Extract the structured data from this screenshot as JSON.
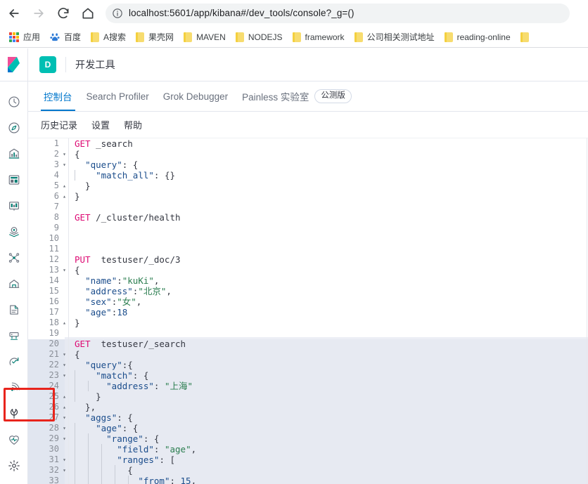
{
  "browser": {
    "nav": {
      "back": "back-arrow",
      "forward": "forward-arrow",
      "reload": "reload",
      "home": "home"
    },
    "omnibox": {
      "info_icon": "page-info-icon",
      "url": "localhost:5601/app/kibana#/dev_tools/console?_g=()"
    },
    "bookmarks": [
      {
        "label": "应用",
        "icon": "apps-grid-icon"
      },
      {
        "label": "百度",
        "icon": "baidu-icon"
      },
      {
        "label": "A搜索",
        "icon": "folder-icon"
      },
      {
        "label": "果壳网",
        "icon": "folder-icon"
      },
      {
        "label": "MAVEN",
        "icon": "folder-icon"
      },
      {
        "label": "NODEJS",
        "icon": "folder-icon"
      },
      {
        "label": "framework",
        "icon": "folder-icon"
      },
      {
        "label": "公司相关测试地址",
        "icon": "folder-icon"
      },
      {
        "label": "reading-online",
        "icon": "folder-icon"
      },
      {
        "label": "",
        "icon": "folder-icon"
      }
    ]
  },
  "kibana": {
    "logo": "kibana-logo",
    "app_badge": "D",
    "app_title": "开发工具",
    "tabs": [
      {
        "label": "控制台",
        "active": true
      },
      {
        "label": "Search Profiler",
        "active": false
      },
      {
        "label": "Grok Debugger",
        "active": false
      },
      {
        "label": "Painless 实验室",
        "active": false,
        "badge": "公测版"
      }
    ],
    "subbar": [
      {
        "label": "历史记录"
      },
      {
        "label": "设置"
      },
      {
        "label": "帮助"
      }
    ],
    "sidebar": [
      {
        "name": "recently-viewed-icon",
        "icon": "clock"
      },
      {
        "name": "discover-icon",
        "icon": "compass"
      },
      {
        "name": "visualize-icon",
        "icon": "bar-chart"
      },
      {
        "name": "dashboard-icon",
        "icon": "dashboard"
      },
      {
        "name": "canvas-icon",
        "icon": "canvas"
      },
      {
        "name": "maps-icon",
        "icon": "map-marker"
      },
      {
        "name": "machine-learning-icon",
        "icon": "ml-nodes"
      },
      {
        "name": "infrastructure-icon",
        "icon": "infra"
      },
      {
        "name": "logs-icon",
        "icon": "logs"
      },
      {
        "name": "apm-icon",
        "icon": "apm"
      },
      {
        "name": "uptime-icon",
        "icon": "uptime"
      },
      {
        "name": "siem-icon",
        "icon": "siem"
      },
      {
        "name": "dev-tools-icon",
        "icon": "wrench",
        "highlighted": true
      },
      {
        "name": "monitoring-icon",
        "icon": "heart-pulse"
      },
      {
        "name": "management-icon",
        "icon": "gear"
      }
    ],
    "console": {
      "selection_start_line": 20,
      "lines": [
        {
          "n": 1,
          "fold": "",
          "indent": 0,
          "tokens": [
            {
              "t": "GET",
              "c": "k-method"
            },
            {
              "t": " _search",
              "c": "k-url"
            }
          ]
        },
        {
          "n": 2,
          "fold": "▾",
          "indent": 0,
          "tokens": [
            {
              "t": "{",
              "c": "k-punc"
            }
          ]
        },
        {
          "n": 3,
          "fold": "▾",
          "indent": 0,
          "tokens": [
            {
              "t": "  ",
              "c": "k-punc"
            },
            {
              "t": "\"query\"",
              "c": "k-key"
            },
            {
              "t": ": {",
              "c": "k-punc"
            }
          ]
        },
        {
          "n": 4,
          "fold": "",
          "indent": 1,
          "tokens": [
            {
              "t": "    ",
              "c": "k-punc"
            },
            {
              "t": "\"match_all\"",
              "c": "k-key"
            },
            {
              "t": ": {}",
              "c": "k-punc"
            }
          ]
        },
        {
          "n": 5,
          "fold": "▴",
          "indent": 0,
          "tokens": [
            {
              "t": "  }",
              "c": "k-punc"
            }
          ]
        },
        {
          "n": 6,
          "fold": "▴",
          "indent": 0,
          "tokens": [
            {
              "t": "}",
              "c": "k-punc"
            }
          ]
        },
        {
          "n": 7,
          "fold": "",
          "indent": 0,
          "tokens": []
        },
        {
          "n": 8,
          "fold": "",
          "indent": 0,
          "tokens": [
            {
              "t": "GET",
              "c": "k-method"
            },
            {
              "t": " /_cluster/health",
              "c": "k-url"
            }
          ]
        },
        {
          "n": 9,
          "fold": "",
          "indent": 0,
          "tokens": []
        },
        {
          "n": 10,
          "fold": "",
          "indent": 0,
          "tokens": []
        },
        {
          "n": 11,
          "fold": "",
          "indent": 0,
          "tokens": []
        },
        {
          "n": 12,
          "fold": "",
          "indent": 0,
          "tokens": [
            {
              "t": "PUT",
              "c": "k-method"
            },
            {
              "t": "  testuser/_doc/3",
              "c": "k-url"
            }
          ]
        },
        {
          "n": 13,
          "fold": "▾",
          "indent": 0,
          "tokens": [
            {
              "t": "{",
              "c": "k-punc"
            }
          ]
        },
        {
          "n": 14,
          "fold": "",
          "indent": 0,
          "tokens": [
            {
              "t": "  ",
              "c": "k-punc"
            },
            {
              "t": "\"name\"",
              "c": "k-key"
            },
            {
              "t": ":",
              "c": "k-punc"
            },
            {
              "t": "\"kuKi\"",
              "c": "k-str"
            },
            {
              "t": ",",
              "c": "k-punc"
            }
          ]
        },
        {
          "n": 15,
          "fold": "",
          "indent": 0,
          "tokens": [
            {
              "t": "  ",
              "c": "k-punc"
            },
            {
              "t": "\"address\"",
              "c": "k-key"
            },
            {
              "t": ":",
              "c": "k-punc"
            },
            {
              "t": "\"北京\"",
              "c": "k-str"
            },
            {
              "t": ",",
              "c": "k-punc"
            }
          ]
        },
        {
          "n": 16,
          "fold": "",
          "indent": 0,
          "tokens": [
            {
              "t": "  ",
              "c": "k-punc"
            },
            {
              "t": "\"sex\"",
              "c": "k-key"
            },
            {
              "t": ":",
              "c": "k-punc"
            },
            {
              "t": "\"女\"",
              "c": "k-str"
            },
            {
              "t": ",",
              "c": "k-punc"
            }
          ]
        },
        {
          "n": 17,
          "fold": "",
          "indent": 0,
          "tokens": [
            {
              "t": "  ",
              "c": "k-punc"
            },
            {
              "t": "\"age\"",
              "c": "k-key"
            },
            {
              "t": ":",
              "c": "k-punc"
            },
            {
              "t": "18",
              "c": "k-num"
            }
          ]
        },
        {
          "n": 18,
          "fold": "▴",
          "indent": 0,
          "tokens": [
            {
              "t": "}",
              "c": "k-punc"
            }
          ]
        },
        {
          "n": 19,
          "fold": "",
          "indent": 0,
          "tokens": []
        },
        {
          "n": 20,
          "fold": "",
          "indent": 0,
          "tokens": [
            {
              "t": "GET",
              "c": "k-method"
            },
            {
              "t": "  testuser/_search",
              "c": "k-url"
            }
          ]
        },
        {
          "n": 21,
          "fold": "▾",
          "indent": 0,
          "tokens": [
            {
              "t": "{",
              "c": "k-punc"
            }
          ]
        },
        {
          "n": 22,
          "fold": "▾",
          "indent": 0,
          "tokens": [
            {
              "t": "  ",
              "c": "k-punc"
            },
            {
              "t": "\"query\"",
              "c": "k-key"
            },
            {
              "t": ":{",
              "c": "k-punc"
            }
          ]
        },
        {
          "n": 23,
          "fold": "▾",
          "indent": 1,
          "tokens": [
            {
              "t": "    ",
              "c": "k-punc"
            },
            {
              "t": "\"match\"",
              "c": "k-key"
            },
            {
              "t": ": {",
              "c": "k-punc"
            }
          ]
        },
        {
          "n": 24,
          "fold": "",
          "indent": 2,
          "tokens": [
            {
              "t": "      ",
              "c": "k-punc"
            },
            {
              "t": "\"address\"",
              "c": "k-key"
            },
            {
              "t": ": ",
              "c": "k-punc"
            },
            {
              "t": "\"上海\"",
              "c": "k-str"
            }
          ]
        },
        {
          "n": 25,
          "fold": "▴",
          "indent": 1,
          "tokens": [
            {
              "t": "    }",
              "c": "k-punc"
            }
          ]
        },
        {
          "n": 26,
          "fold": "▴",
          "indent": 0,
          "tokens": [
            {
              "t": "  },",
              "c": "k-punc"
            }
          ]
        },
        {
          "n": 27,
          "fold": "▾",
          "indent": 0,
          "tokens": [
            {
              "t": "  ",
              "c": "k-punc"
            },
            {
              "t": "\"aggs\"",
              "c": "k-key"
            },
            {
              "t": ": {",
              "c": "k-punc"
            }
          ]
        },
        {
          "n": 28,
          "fold": "▾",
          "indent": 1,
          "tokens": [
            {
              "t": "    ",
              "c": "k-punc"
            },
            {
              "t": "\"age\"",
              "c": "k-key"
            },
            {
              "t": ": {",
              "c": "k-punc"
            }
          ]
        },
        {
          "n": 29,
          "fold": "▾",
          "indent": 2,
          "tokens": [
            {
              "t": "      ",
              "c": "k-punc"
            },
            {
              "t": "\"range\"",
              "c": "k-key"
            },
            {
              "t": ": {",
              "c": "k-punc"
            }
          ]
        },
        {
          "n": 30,
          "fold": "",
          "indent": 3,
          "tokens": [
            {
              "t": "        ",
              "c": "k-punc"
            },
            {
              "t": "\"field\"",
              "c": "k-key"
            },
            {
              "t": ": ",
              "c": "k-punc"
            },
            {
              "t": "\"age\"",
              "c": "k-str"
            },
            {
              "t": ",",
              "c": "k-punc"
            }
          ]
        },
        {
          "n": 31,
          "fold": "▾",
          "indent": 3,
          "tokens": [
            {
              "t": "        ",
              "c": "k-punc"
            },
            {
              "t": "\"ranges\"",
              "c": "k-key"
            },
            {
              "t": ": [",
              "c": "k-punc"
            }
          ]
        },
        {
          "n": 32,
          "fold": "▾",
          "indent": 4,
          "tokens": [
            {
              "t": "          {",
              "c": "k-punc"
            }
          ]
        },
        {
          "n": 33,
          "fold": "",
          "indent": 5,
          "tokens": [
            {
              "t": "            ",
              "c": "k-punc"
            },
            {
              "t": "\"from\"",
              "c": "k-key"
            },
            {
              "t": ": ",
              "c": "k-punc"
            },
            {
              "t": "15",
              "c": "k-num"
            },
            {
              "t": ",",
              "c": "k-punc"
            }
          ]
        }
      ]
    }
  }
}
